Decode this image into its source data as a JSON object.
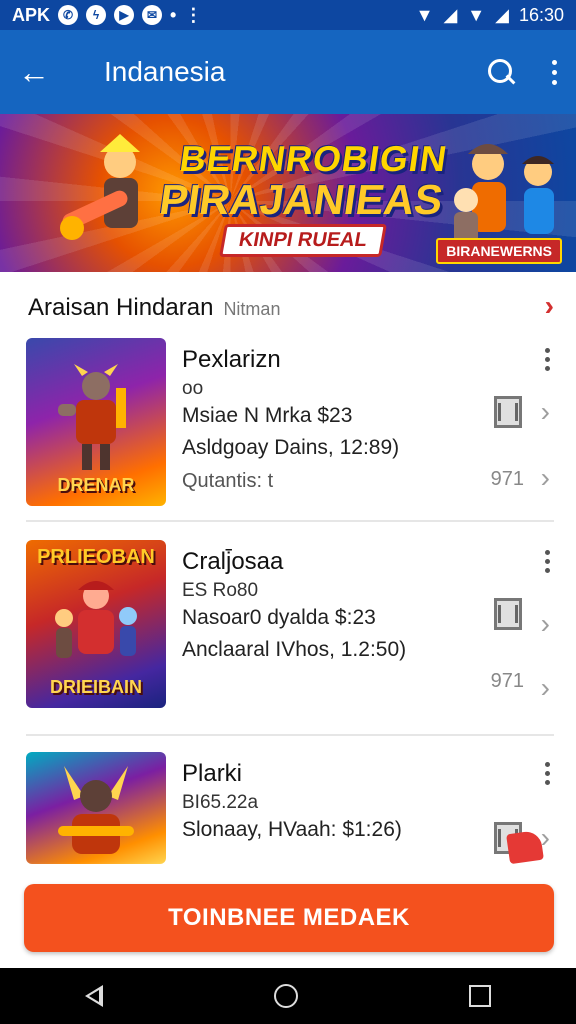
{
  "status_bar": {
    "left_text": "APK",
    "time": "16:30",
    "icons": [
      "whatsapp-icon",
      "messenger-icon",
      "youtube-icon",
      "mail-icon",
      "dot-icon",
      "more-vert-icon",
      "wifi-icon",
      "signal-icon",
      "wifi-icon",
      "signal-icon"
    ]
  },
  "app_bar": {
    "title": "Indanesia",
    "back_icon": "arrow-back-icon",
    "search_icon": "search-icon",
    "menu_icon": "more-vert-icon"
  },
  "banner": {
    "headline_1": "BERNROBIGIN",
    "headline_2": "PIRAJANIEAS",
    "tag": "KINPI RUEAL",
    "tag_2": "BIRANEWERNS"
  },
  "section": {
    "title": "Araisan Hindaran",
    "subtitle": "Nitman"
  },
  "apps": [
    {
      "name": "Pexlarizn",
      "meta_1": "oo",
      "meta_2": "Msiae N Mrka    $23",
      "meta_3": "Asldgoay Dains,  12:89)",
      "meta_4": "Qutantis: t",
      "count": "971",
      "thumb_caption": "DRENAR",
      "thumb_top": ""
    },
    {
      "name": "Cralj̄osaa",
      "meta_1": "ES Ro80",
      "meta_2": "Nasoar0 dyalda  $:23",
      "meta_3": "Anclaaral IVhos, 1.2:50)",
      "meta_4": "",
      "count": "971",
      "thumb_caption": "DRIEIBAIN",
      "thumb_top": "PRLIEOBAN"
    },
    {
      "name": "Plarki",
      "meta_1": "BI65.22a",
      "meta_2": "Slonaay, HVaah:  $1:26)",
      "meta_3": "",
      "meta_4": "",
      "count": "",
      "thumb_caption": "",
      "thumb_top": ""
    }
  ],
  "cta": {
    "label": "TOINBNEE MEDAEK"
  },
  "nav": {
    "back": "nav-back-icon",
    "home": "nav-home-icon",
    "recents": "nav-recents-icon"
  },
  "colors": {
    "app_bar": "#1565c0",
    "status_bar": "#0d47a1",
    "cta": "#f4511e",
    "chevron_accent": "#d32f2f"
  }
}
